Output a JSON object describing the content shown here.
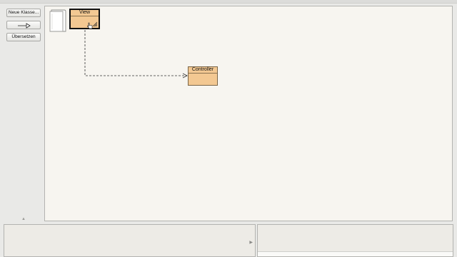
{
  "toolbar": {
    "new_class_label": "Neue Klasse...",
    "arrow_button_icon": "inheritance-arrow-icon",
    "compile_label": "Übersetzen"
  },
  "diagram": {
    "classes": [
      {
        "name": "View",
        "selected": true
      },
      {
        "name": "Controller",
        "selected": false
      }
    ],
    "relations": [
      {
        "from": "View",
        "to": "Controller",
        "kind": "dependency-dashed"
      }
    ],
    "package_icon": "document-icon"
  },
  "colors": {
    "class_fill": "#f3c892",
    "canvas_bg": "#f7f5f0",
    "chrome_bg": "#e9e9e7"
  }
}
